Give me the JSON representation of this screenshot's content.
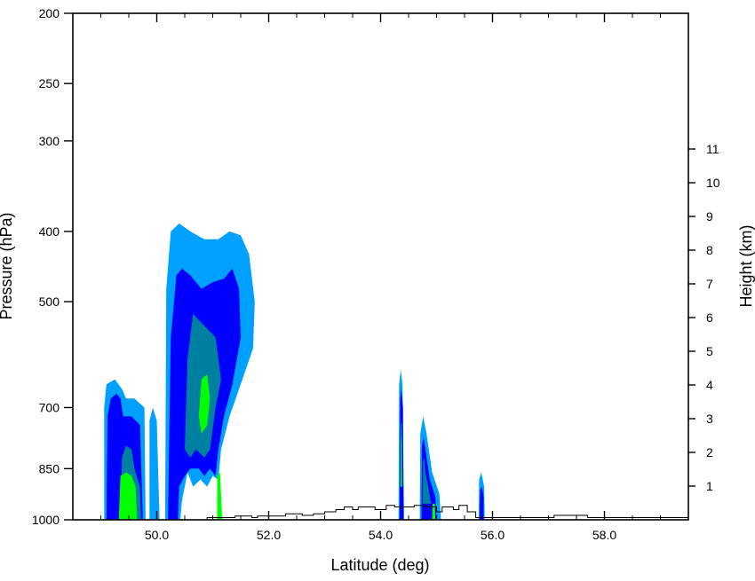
{
  "chart_data": {
    "type": "contour",
    "title": "",
    "xlabel": "Latitude (deg)",
    "ylabel_left": "Pressure (hPa)",
    "ylabel_right": "Height (km)",
    "xlim": [
      48.5,
      59.5
    ],
    "ylim_pressure": [
      1000,
      200
    ],
    "y_scale": "log-pressure",
    "x_ticks": [
      {
        "value": 50.0,
        "label": "50.0"
      },
      {
        "value": 52.0,
        "label": "52.0"
      },
      {
        "value": 54.0,
        "label": "54.0"
      },
      {
        "value": 56.0,
        "label": "56.0"
      },
      {
        "value": 58.0,
        "label": "58.0"
      }
    ],
    "x_minor_ticks": [
      48.5,
      49.0,
      49.5,
      50.5,
      51.0,
      51.5,
      52.5,
      53.0,
      53.5,
      54.5,
      55.0,
      55.5,
      56.5,
      57.0,
      57.5,
      58.5,
      59.0
    ],
    "y_ticks": [
      {
        "value": 1000,
        "label": "1000"
      },
      {
        "value": 850,
        "label": "850"
      },
      {
        "value": 700,
        "label": "700"
      },
      {
        "value": 500,
        "label": "500"
      },
      {
        "value": 400,
        "label": "400"
      },
      {
        "value": 300,
        "label": "300"
      },
      {
        "value": 250,
        "label": "250"
      },
      {
        "value": 200,
        "label": "200"
      }
    ],
    "height_ticks": [
      {
        "value": 1,
        "label": "1"
      },
      {
        "value": 2,
        "label": "2"
      },
      {
        "value": 3,
        "label": "3"
      },
      {
        "value": 4,
        "label": "4"
      },
      {
        "value": 5,
        "label": "5"
      },
      {
        "value": 6,
        "label": "6"
      },
      {
        "value": 7,
        "label": "7"
      },
      {
        "value": 8,
        "label": "8"
      },
      {
        "value": 9,
        "label": "9"
      },
      {
        "value": 10,
        "label": "10"
      },
      {
        "value": 11,
        "label": "11"
      }
    ],
    "levels": [
      {
        "color": "#00a0ff",
        "name": "level-1"
      },
      {
        "color": "#0000ff",
        "name": "level-2"
      },
      {
        "color": "#0080a0",
        "name": "level-3"
      },
      {
        "color": "#00ff00",
        "name": "level-4"
      }
    ],
    "regions": [
      {
        "level": 0,
        "points": [
          [
            49.06,
            1000
          ],
          [
            49.06,
            700
          ],
          [
            49.1,
            650
          ],
          [
            49.25,
            640
          ],
          [
            49.38,
            660
          ],
          [
            49.45,
            680
          ],
          [
            49.6,
            680
          ],
          [
            49.78,
            700
          ],
          [
            49.8,
            1000
          ]
        ]
      },
      {
        "level": 0,
        "points": [
          [
            49.87,
            1000
          ],
          [
            49.87,
            730
          ],
          [
            49.93,
            700
          ],
          [
            50.0,
            730
          ],
          [
            50.05,
            1000
          ]
        ]
      },
      {
        "level": 0,
        "points": [
          [
            50.15,
            1000
          ],
          [
            50.17,
            480
          ],
          [
            50.25,
            400
          ],
          [
            50.4,
            390
          ],
          [
            50.6,
            400
          ],
          [
            50.85,
            410
          ],
          [
            51.1,
            410
          ],
          [
            51.3,
            400
          ],
          [
            51.5,
            405
          ],
          [
            51.65,
            430
          ],
          [
            51.75,
            500
          ],
          [
            51.72,
            580
          ],
          [
            51.5,
            650
          ],
          [
            51.3,
            720
          ],
          [
            51.15,
            800
          ],
          [
            51.1,
            880
          ],
          [
            51.0,
            870
          ],
          [
            50.9,
            900
          ],
          [
            50.78,
            880
          ],
          [
            50.65,
            900
          ],
          [
            50.6,
            880
          ],
          [
            50.55,
            860
          ],
          [
            50.5,
            900
          ],
          [
            50.45,
            940
          ],
          [
            50.42,
            1000
          ]
        ]
      },
      {
        "level": 1,
        "points": [
          [
            49.1,
            1000
          ],
          [
            49.12,
            720
          ],
          [
            49.18,
            680
          ],
          [
            49.28,
            670
          ],
          [
            49.35,
            680
          ],
          [
            49.4,
            720
          ],
          [
            49.55,
            720
          ],
          [
            49.7,
            740
          ],
          [
            49.75,
            1000
          ]
        ]
      },
      {
        "level": 1,
        "points": [
          [
            50.2,
            1000
          ],
          [
            50.25,
            560
          ],
          [
            50.35,
            460
          ],
          [
            50.45,
            450
          ],
          [
            50.6,
            460
          ],
          [
            50.8,
            480
          ],
          [
            51.0,
            470
          ],
          [
            51.2,
            465
          ],
          [
            51.35,
            450
          ],
          [
            51.47,
            480
          ],
          [
            51.5,
            560
          ],
          [
            51.35,
            650
          ],
          [
            51.2,
            720
          ],
          [
            51.1,
            800
          ],
          [
            51.05,
            870
          ],
          [
            50.95,
            850
          ],
          [
            50.85,
            870
          ],
          [
            50.75,
            850
          ],
          [
            50.6,
            850
          ],
          [
            50.5,
            870
          ],
          [
            50.4,
            900
          ],
          [
            50.38,
            1000
          ]
        ]
      },
      {
        "level": 2,
        "points": [
          [
            49.35,
            1000
          ],
          [
            49.38,
            820
          ],
          [
            49.45,
            790
          ],
          [
            49.55,
            800
          ],
          [
            49.6,
            850
          ],
          [
            49.7,
            900
          ],
          [
            49.72,
            1000
          ]
        ]
      },
      {
        "level": 2,
        "points": [
          [
            50.5,
            800
          ],
          [
            50.55,
            600
          ],
          [
            50.65,
            520
          ],
          [
            50.85,
            540
          ],
          [
            51.05,
            560
          ],
          [
            51.15,
            640
          ],
          [
            51.05,
            700
          ],
          [
            50.95,
            800
          ],
          [
            50.85,
            820
          ],
          [
            50.7,
            800
          ],
          [
            50.6,
            820
          ]
        ]
      },
      {
        "level": 3,
        "points": [
          [
            49.32,
            1000
          ],
          [
            49.35,
            870
          ],
          [
            49.45,
            860
          ],
          [
            49.55,
            870
          ],
          [
            49.62,
            900
          ],
          [
            49.65,
            1000
          ]
        ]
      },
      {
        "level": 3,
        "points": [
          [
            50.75,
            720
          ],
          [
            50.8,
            640
          ],
          [
            50.9,
            630
          ],
          [
            50.95,
            680
          ],
          [
            50.9,
            740
          ],
          [
            50.8,
            760
          ]
        ]
      },
      {
        "level": 3,
        "points": [
          [
            51.08,
            1000
          ],
          [
            51.08,
            870
          ],
          [
            51.13,
            860
          ],
          [
            51.17,
            1000
          ]
        ]
      },
      {
        "level": 0,
        "points": [
          [
            54.32,
            1000
          ],
          [
            54.33,
            650
          ],
          [
            54.36,
            620
          ],
          [
            54.39,
            650
          ],
          [
            54.42,
            1000
          ]
        ]
      },
      {
        "level": 1,
        "points": [
          [
            54.34,
            1000
          ],
          [
            54.35,
            680
          ],
          [
            54.37,
            660
          ],
          [
            54.4,
            700
          ],
          [
            54.41,
            1000
          ]
        ]
      },
      {
        "level": 2,
        "points": [
          [
            54.35,
            900
          ],
          [
            54.36,
            740
          ],
          [
            54.38,
            730
          ],
          [
            54.39,
            780
          ],
          [
            54.39,
            900
          ]
        ]
      },
      {
        "level": 3,
        "points": [
          [
            54.36,
            900
          ],
          [
            54.365,
            780
          ],
          [
            54.375,
            770
          ],
          [
            54.38,
            900
          ]
        ]
      },
      {
        "level": 0,
        "points": [
          [
            54.7,
            1000
          ],
          [
            54.71,
            760
          ],
          [
            54.76,
            720
          ],
          [
            54.82,
            760
          ],
          [
            54.92,
            860
          ],
          [
            55.05,
            920
          ],
          [
            55.08,
            1000
          ]
        ]
      },
      {
        "level": 1,
        "points": [
          [
            54.73,
            1000
          ],
          [
            54.74,
            790
          ],
          [
            54.77,
            770
          ],
          [
            54.8,
            800
          ],
          [
            54.88,
            880
          ],
          [
            54.98,
            930
          ],
          [
            55.0,
            1000
          ]
        ]
      },
      {
        "level": 2,
        "points": [
          [
            54.75,
            950
          ],
          [
            54.76,
            830
          ],
          [
            54.78,
            820
          ],
          [
            54.8,
            860
          ],
          [
            54.85,
            900
          ],
          [
            54.9,
            950
          ]
        ]
      },
      {
        "level": 3,
        "points": [
          [
            54.92,
            1000
          ],
          [
            54.93,
            950
          ],
          [
            54.97,
            950
          ],
          [
            54.98,
            1000
          ]
        ]
      },
      {
        "level": 0,
        "points": [
          [
            55.75,
            1000
          ],
          [
            55.76,
            880
          ],
          [
            55.8,
            860
          ],
          [
            55.85,
            900
          ],
          [
            55.86,
            1000
          ]
        ]
      },
      {
        "level": 1,
        "points": [
          [
            55.77,
            1000
          ],
          [
            55.78,
            910
          ],
          [
            55.81,
            900
          ],
          [
            55.84,
            930
          ],
          [
            55.84,
            1000
          ]
        ]
      }
    ],
    "terrain_outline": [
      [
        50.9,
        1000
      ],
      [
        50.9,
        993
      ],
      [
        51.4,
        993
      ],
      [
        51.4,
        988
      ],
      [
        51.7,
        988
      ],
      [
        51.7,
        993
      ],
      [
        51.8,
        993
      ],
      [
        51.8,
        988
      ],
      [
        52.3,
        988
      ],
      [
        52.3,
        981
      ],
      [
        52.6,
        981
      ],
      [
        52.6,
        986
      ],
      [
        52.8,
        986
      ],
      [
        52.8,
        981
      ],
      [
        53.0,
        981
      ],
      [
        53.0,
        975
      ],
      [
        53.2,
        975
      ],
      [
        53.2,
        968
      ],
      [
        53.35,
        968
      ],
      [
        53.35,
        960
      ],
      [
        53.5,
        960
      ],
      [
        53.5,
        968
      ],
      [
        53.6,
        968
      ],
      [
        53.6,
        960
      ],
      [
        53.9,
        960
      ],
      [
        53.9,
        968
      ],
      [
        54.1,
        968
      ],
      [
        54.1,
        955
      ],
      [
        54.25,
        955
      ],
      [
        54.25,
        960
      ],
      [
        54.6,
        960
      ],
      [
        54.6,
        955
      ],
      [
        54.8,
        955
      ],
      [
        54.8,
        960
      ],
      [
        55.0,
        960
      ],
      [
        55.0,
        975
      ],
      [
        55.1,
        975
      ],
      [
        55.1,
        960
      ],
      [
        55.3,
        960
      ],
      [
        55.3,
        968
      ],
      [
        55.4,
        968
      ],
      [
        55.4,
        955
      ],
      [
        55.55,
        955
      ],
      [
        55.55,
        975
      ],
      [
        55.7,
        975
      ],
      [
        55.7,
        993
      ],
      [
        57.1,
        993
      ],
      [
        57.1,
        986
      ],
      [
        57.7,
        986
      ],
      [
        57.7,
        993
      ],
      [
        59.5,
        993
      ],
      [
        59.5,
        1000
      ]
    ]
  }
}
